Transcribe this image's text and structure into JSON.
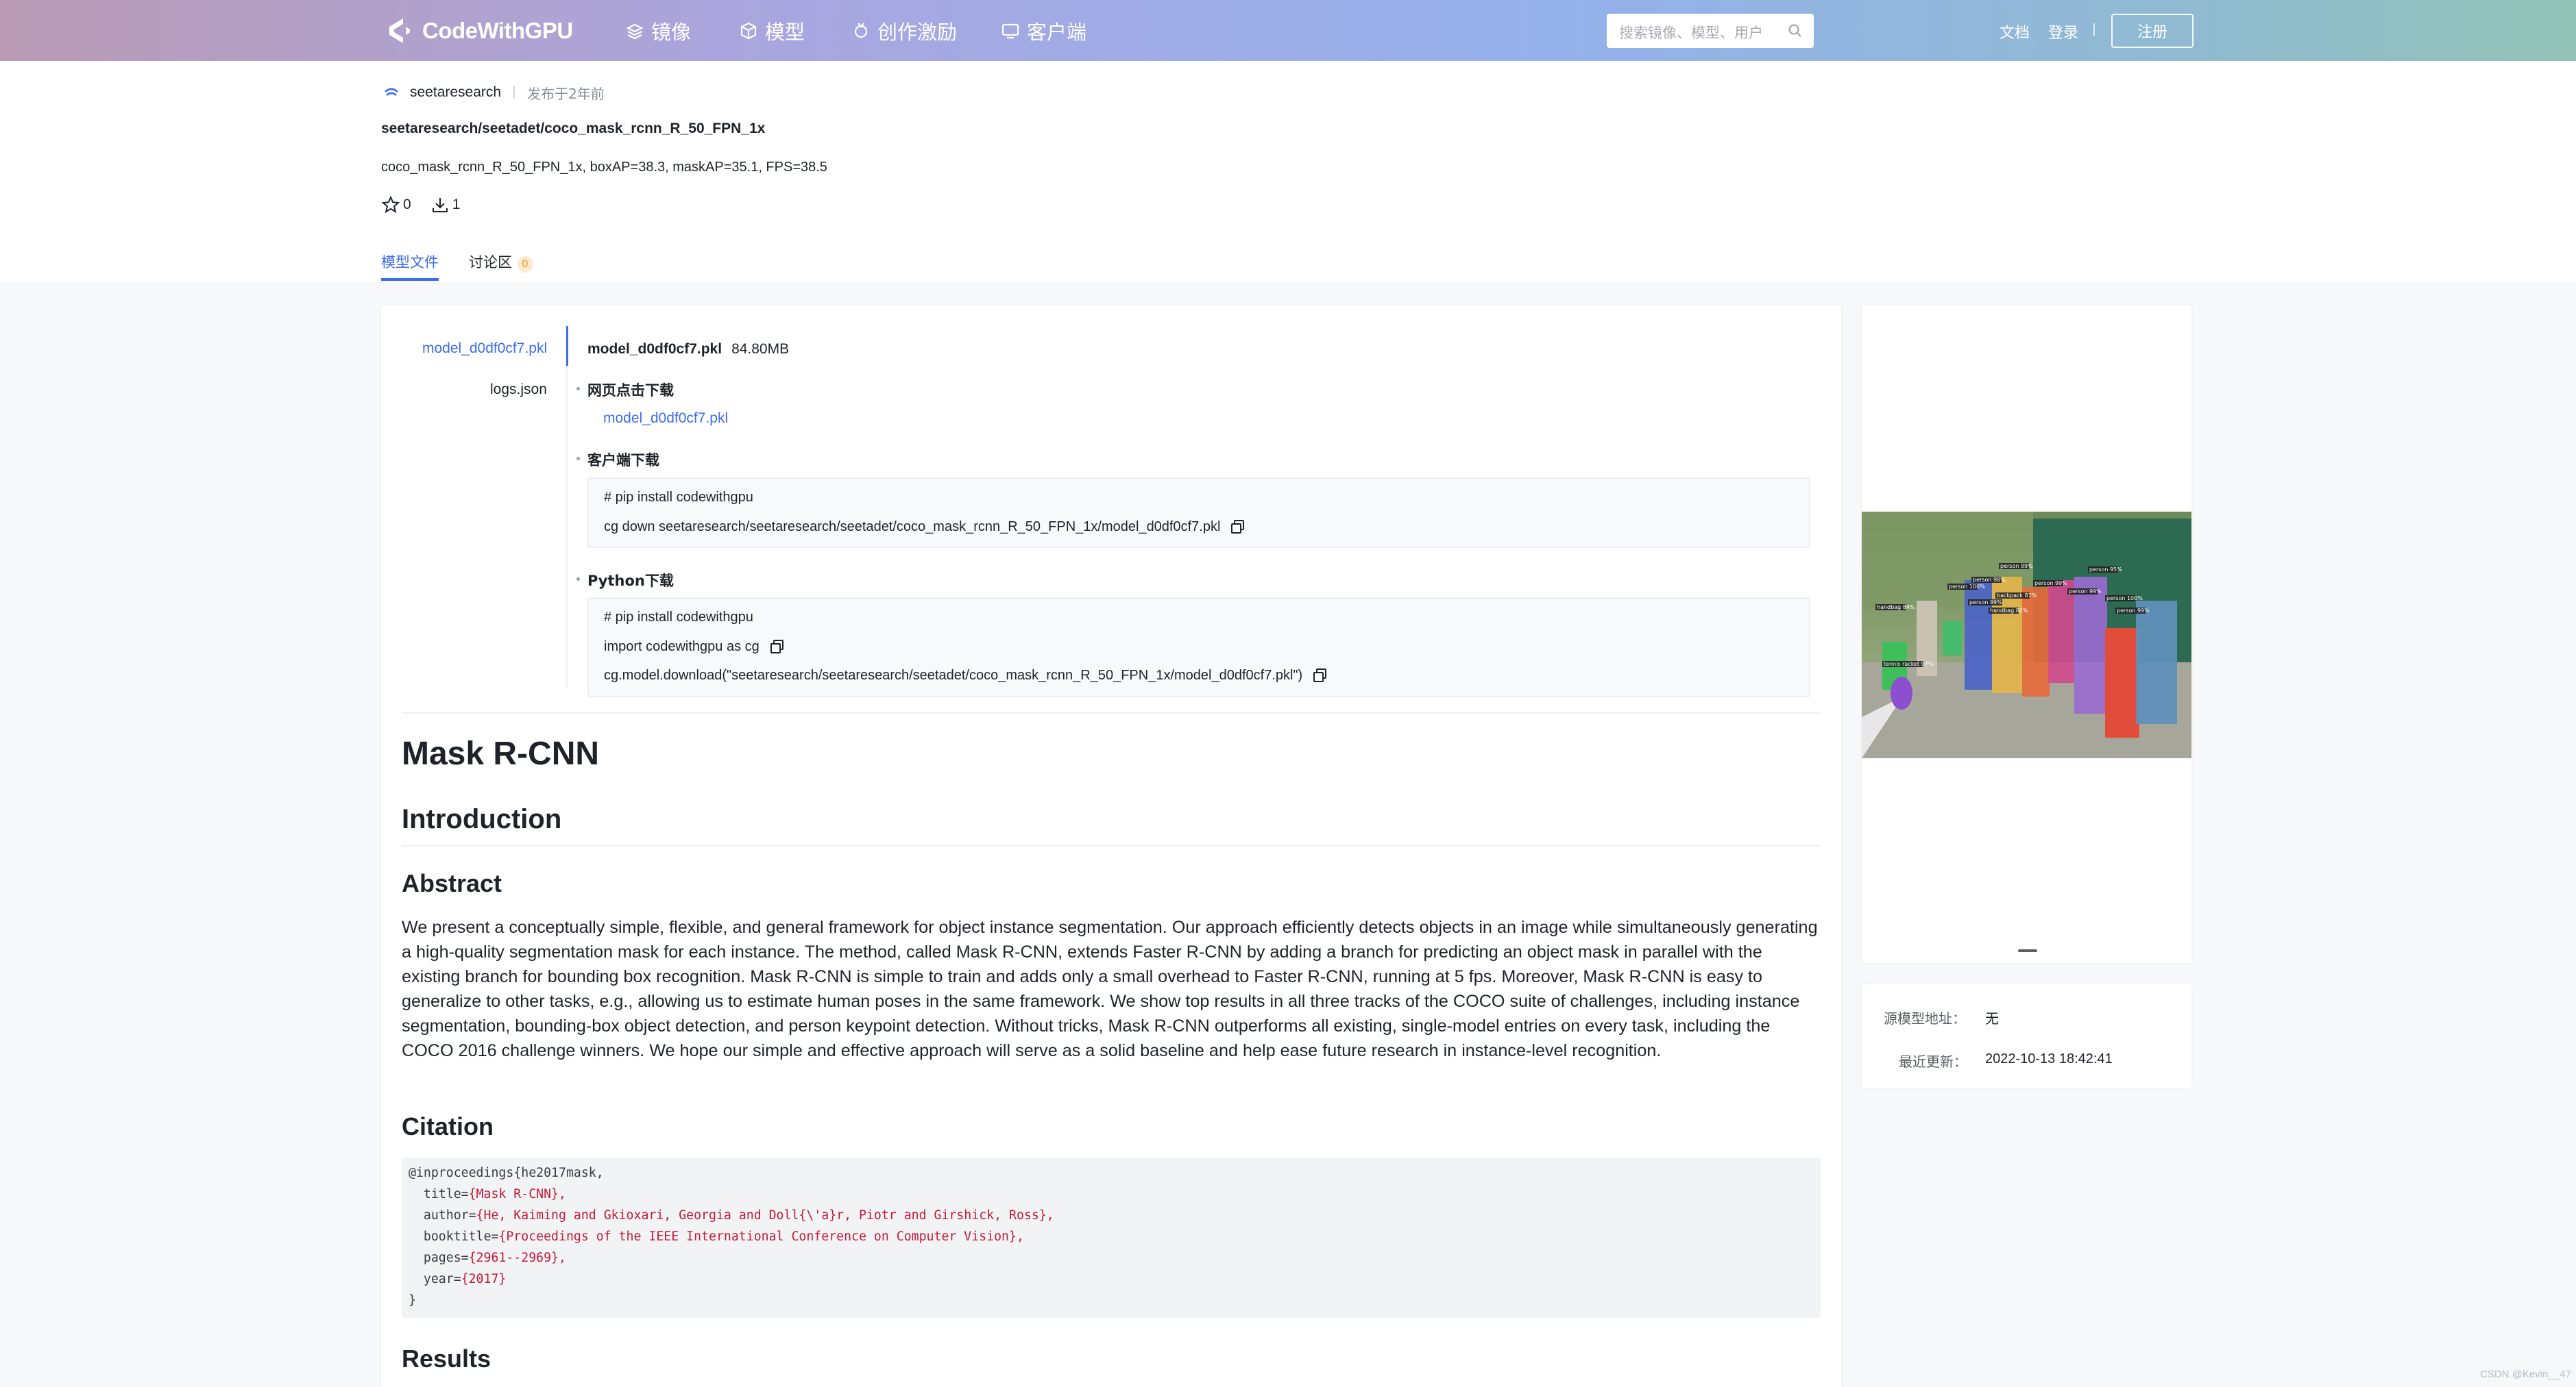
{
  "header": {
    "brand": "CodeWithGPU",
    "nav": [
      "镜像",
      "模型",
      "创作激励",
      "客户端"
    ],
    "search_placeholder": "搜索镜像、模型、用户",
    "links": [
      "文档",
      "登录"
    ],
    "register": "注册"
  },
  "model": {
    "publisher": "seetaresearch",
    "published_time": "发布于2年前",
    "path": "seetaresearch/seetadet/coco_mask_rcnn_R_50_FPN_1x",
    "description": "coco_mask_rcnn_R_50_FPN_1x, boxAP=38.3, maskAP=35.1, FPS=38.5",
    "stars": "0",
    "downloads": "1"
  },
  "tabs": [
    {
      "label": "模型文件",
      "active": true
    },
    {
      "label": "讨论区",
      "badge": "0"
    }
  ],
  "files": [
    "model_d0df0cf7.pkl",
    "logs.json"
  ],
  "file_detail": {
    "name": "model_d0df0cf7.pkl",
    "size": "84.80MB",
    "web_title": "网页点击下载",
    "web_link": "model_d0df0cf7.pkl",
    "client_title": "客户端下载",
    "client_lines": [
      "# pip install codewithgpu",
      "cg down seetaresearch/seetaresearch/seetadet/coco_mask_rcnn_R_50_FPN_1x/model_d0df0cf7.pkl"
    ],
    "python_title": "Python下载",
    "python_lines": [
      "# pip install codewithgpu",
      "import codewithgpu as cg",
      "cg.model.download(\"seetaresearch/seetaresearch/seetadet/coco_mask_rcnn_R_50_FPN_1x/model_d0df0cf7.pkl\")"
    ]
  },
  "readme": {
    "title": "Mask R-CNN",
    "introduction": "Introduction",
    "abstract_heading": "Abstract",
    "abstract": "We present a conceptually simple, flexible, and general framework for object instance segmentation. Our approach efficiently detects objects in an image while simultaneously generating a high-quality segmentation mask for each instance. The method, called Mask R-CNN, extends Faster R-CNN by adding a branch for predicting an object mask in parallel with the existing branch for bounding box recognition. Mask R-CNN is simple to train and adds only a small overhead to Faster R-CNN, running at 5 fps. Moreover, Mask R-CNN is easy to generalize to other tasks, e.g., allowing us to estimate human poses in the same framework. We show top results in all three tracks of the COCO suite of challenges, including instance segmentation, bounding-box object detection, and person keypoint detection. Without tricks, Mask R-CNN outperforms all existing, single-model entries on every task, including the COCO 2016 challenge winners. We hope our simple and effective approach will serve as a solid baseline and help ease future research in instance-level recognition.",
    "citation_heading": "Citation",
    "citation": [
      {
        "k": "@inproceedings{he2017mask,",
        "v": ""
      },
      {
        "k": "  title=",
        "v": "{Mask R-CNN},"
      },
      {
        "k": "  author=",
        "v": "{He, Kaiming and Gkioxari, Georgia and Doll{\\'a}r, Piotr and Girshick, Ross},"
      },
      {
        "k": "  booktitle=",
        "v": "{Proceedings of the IEEE International Conference on Computer Vision},"
      },
      {
        "k": "  pages=",
        "v": "{2961--2969},"
      },
      {
        "k": "  year=",
        "v": "{2017}"
      },
      {
        "k": "}",
        "v": ""
      }
    ],
    "results_heading": "Results"
  },
  "info": {
    "source_label": "源模型地址：",
    "source_value": "无",
    "updated_label": "最近更新：",
    "updated_value": "2022-10-13 18:42:41"
  },
  "detections": [
    "person 99%",
    "person 95%",
    "person 98%",
    "person 99%",
    "person 99%",
    "person 100%",
    "person 100%",
    "person 99%",
    "handbag 82%",
    "handbag 84%",
    "backpack 87%",
    "person 99%",
    "tennis racket 97%"
  ],
  "credit": "CSDN @Kevin__47",
  "colors": {
    "accent": "#3c6cf0",
    "code_string": "#c41a3a"
  }
}
